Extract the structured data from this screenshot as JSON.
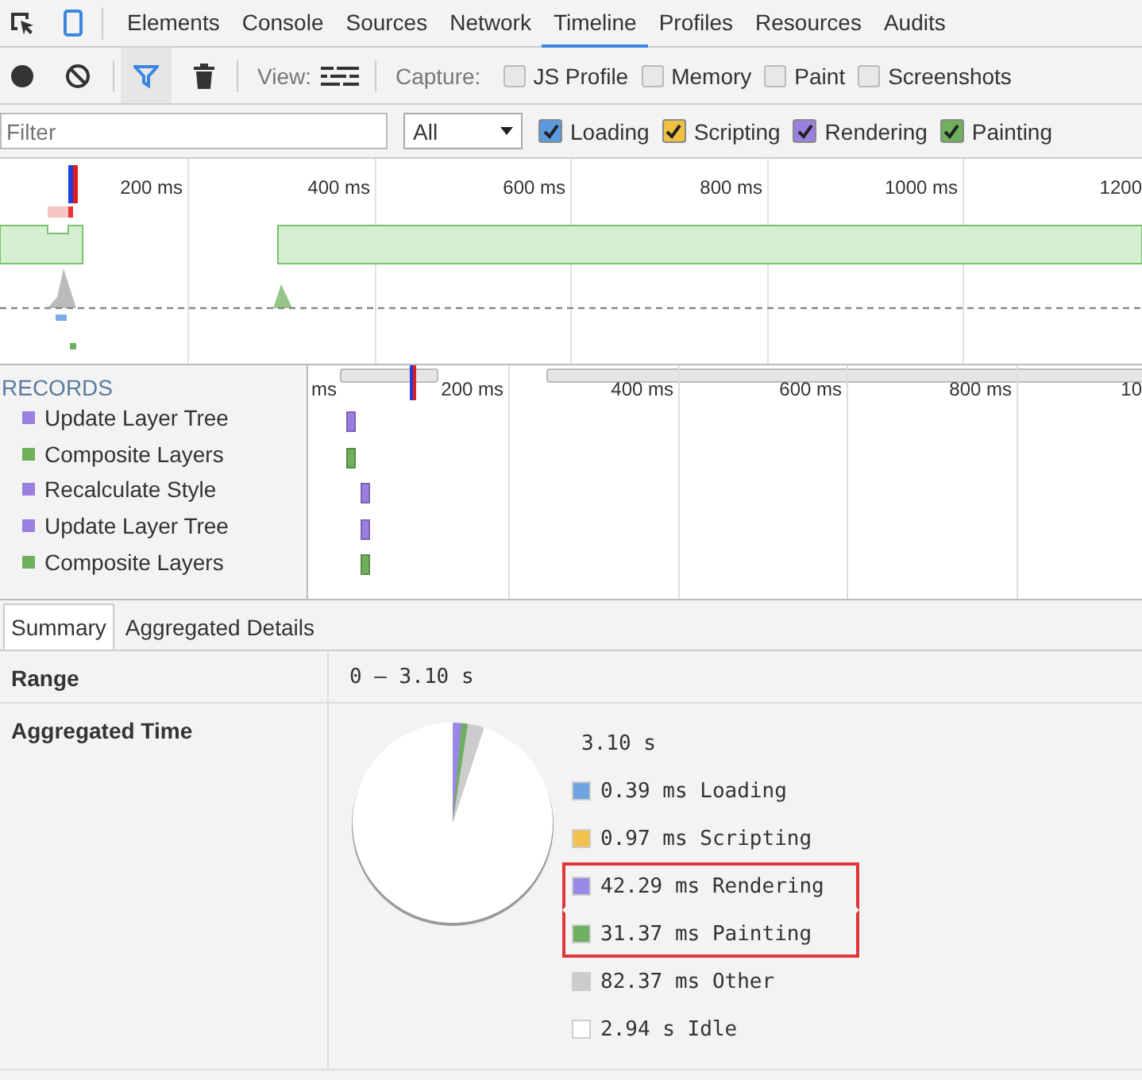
{
  "devtools_tabs": [
    {
      "label": "Elements",
      "selected": false
    },
    {
      "label": "Console",
      "selected": false
    },
    {
      "label": "Sources",
      "selected": false
    },
    {
      "label": "Network",
      "selected": false
    },
    {
      "label": "Timeline",
      "selected": true
    },
    {
      "label": "Profiles",
      "selected": false
    },
    {
      "label": "Resources",
      "selected": false
    },
    {
      "label": "Audits",
      "selected": false
    }
  ],
  "toolbar": {
    "filter_selected": true,
    "view_label": "View:",
    "capture_label": "Capture:",
    "capture_options": [
      {
        "label": "JS Profile",
        "checked": false
      },
      {
        "label": "Memory",
        "checked": false
      },
      {
        "label": "Paint",
        "checked": false
      },
      {
        "label": "Screenshots",
        "checked": false
      }
    ]
  },
  "filter_bar": {
    "placeholder": "Filter",
    "level_select": "All",
    "categories": [
      {
        "label": "Loading",
        "checked": true,
        "color": "#5a9be0"
      },
      {
        "label": "Scripting",
        "checked": true,
        "color": "#f0c040"
      },
      {
        "label": "Rendering",
        "checked": true,
        "color": "#9a7fe0"
      },
      {
        "label": "Painting",
        "checked": true,
        "color": "#6fb05a"
      }
    ]
  },
  "overview": {
    "ticks": [
      "200 ms",
      "400 ms",
      "600 ms",
      "800 ms",
      "1000 ms",
      "1200"
    ]
  },
  "records": {
    "header": "RECORDS",
    "ticks": [
      "ms",
      "200 ms",
      "400 ms",
      "600 ms",
      "800 ms",
      "10"
    ],
    "items": [
      {
        "name": "Update Layer Tree",
        "color": "#9a7fe0"
      },
      {
        "name": "Composite Layers",
        "color": "#6fb05a"
      },
      {
        "name": "Recalculate Style",
        "color": "#9a7fe0"
      },
      {
        "name": "Update Layer Tree",
        "color": "#9a7fe0"
      },
      {
        "name": "Composite Layers",
        "color": "#6fb05a"
      }
    ]
  },
  "detail_tabs": [
    {
      "label": "Summary",
      "selected": true
    },
    {
      "label": "Aggregated Details",
      "selected": false
    }
  ],
  "summary": {
    "range_label": "Range",
    "range_value": "0 – 3.10 s",
    "aggregated_label": "Aggregated Time",
    "total": "3.10 s",
    "legend": [
      {
        "text": "0.39 ms Loading",
        "color": "#6fa3e0",
        "highlighted": false
      },
      {
        "text": "0.97 ms Scripting",
        "color": "#f2c14e",
        "highlighted": false
      },
      {
        "text": "42.29 ms Rendering",
        "color": "#9a88e8",
        "highlighted": true
      },
      {
        "text": "31.37 ms Painting",
        "color": "#6cb060",
        "highlighted": true
      },
      {
        "text": "82.37 ms Other",
        "color": "#cccccc",
        "highlighted": false
      },
      {
        "text": "2.94 s Idle",
        "color": "#ffffff",
        "highlighted": false
      }
    ]
  }
}
